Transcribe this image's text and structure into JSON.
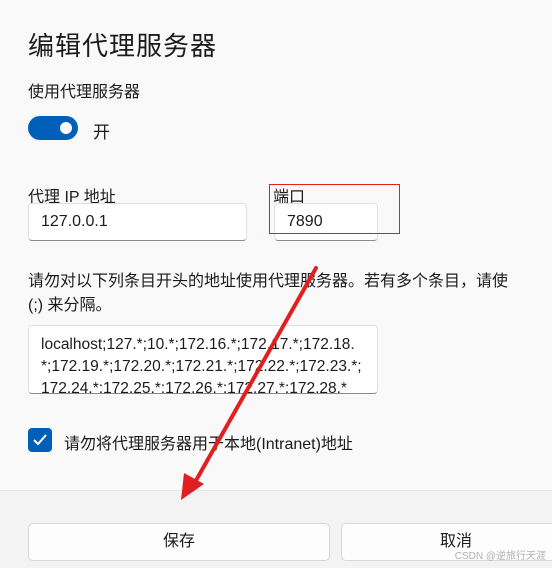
{
  "dialog": {
    "title": "编辑代理服务器",
    "use_proxy_label": "使用代理服务器",
    "toggle_state": "开",
    "proxy_ip_label": "代理 IP 地址",
    "proxy_ip_value": "127.0.0.1",
    "port_label": "端口",
    "port_value": "7890",
    "description": "请勿对以下列条目开头的地址使用代理服务器。若有多个条目，请使\n(;) 来分隔。",
    "exceptions_value": "localhost;127.*;10.*;172.16.*;172.17.*;172.18.*;172.19.*;172.20.*;172.21.*;172.22.*;172.23.*;172.24.*;172.25.*;172.26.*;172.27.*;172.28.*",
    "local_checkbox_label": "请勿将代理服务器用于本地(Intranet)地址",
    "local_checkbox_checked": true,
    "save_label": "保存",
    "cancel_label": "取消"
  },
  "watermark": "CSDN @逆旅行天涯",
  "colors": {
    "accent": "#005fb8",
    "annotation_red": "#e02020"
  }
}
